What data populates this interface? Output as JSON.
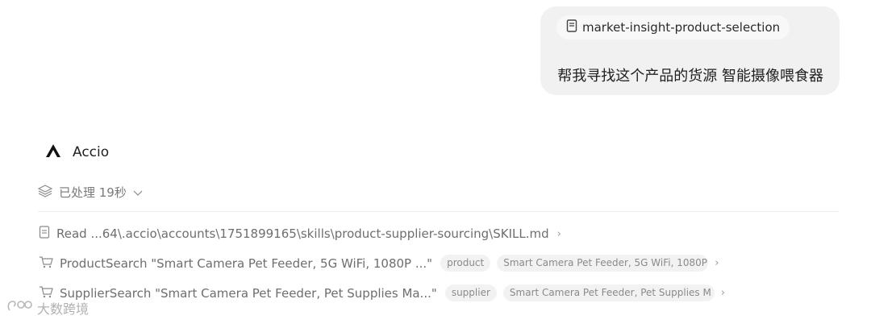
{
  "user_message": {
    "skill_chip": {
      "label": "market-insight-product-selection",
      "icon": "document-icon"
    },
    "text": "帮我寻找这个产品的货源 智能摄像喂食器"
  },
  "assistant": {
    "name": "Accio",
    "logo": "accio-logo-icon"
  },
  "processed": {
    "label": "已处理 19秒",
    "icon": "layers-icon",
    "chevron": "chevron-down-icon"
  },
  "steps": [
    {
      "icon": "document-icon",
      "text": "Read ...64\\.accio\\accounts\\1751899165\\skills\\product-supplier-sourcing\\SKILL.md",
      "tags": []
    },
    {
      "icon": "cart-icon",
      "text": "ProductSearch \"Smart Camera Pet Feeder, 5G WiFi, 1080P ...\"",
      "tags": [
        "product",
        "Smart Camera Pet Feeder, 5G WiFi, 1080P"
      ]
    },
    {
      "icon": "cart-icon",
      "text": "SupplierSearch \"Smart Camera Pet Feeder, Pet Supplies Ma...\"",
      "tags": [
        "supplier",
        "Smart Camera Pet Feeder, Pet Supplies M"
      ]
    }
  ],
  "watermark": {
    "text": "大数跨境"
  },
  "colors": {
    "bubble": "#f1f1f2",
    "muted_text": "#6e6e6e",
    "tag_bg": "#f2f2f3"
  }
}
